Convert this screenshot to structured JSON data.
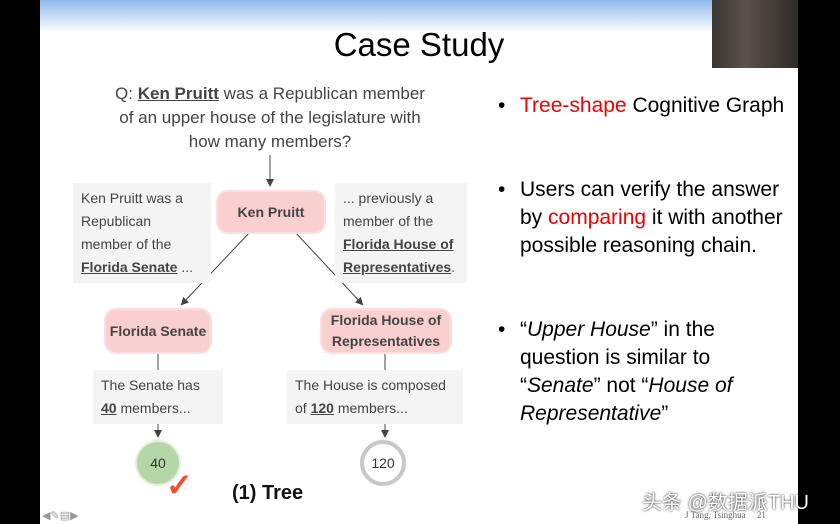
{
  "title": "Case Study",
  "question": {
    "prefix": "Q: ",
    "entity": "Ken Pruitt",
    "rest1": " was a Republican member",
    "line2": "of an upper house of the legislature with",
    "line3": "how many members?"
  },
  "boxes": {
    "left": {
      "text": "Ken Pruitt was a Republican member of the ",
      "link": "Florida Senate",
      "suffix": " ..."
    },
    "right": {
      "text": "... previously a member of the ",
      "link": "Florida House of Representatives",
      "suffix": "."
    },
    "senate": {
      "text": "The Senate has ",
      "num": "40",
      "suffix": " members..."
    },
    "house": {
      "text": "The House is composed of ",
      "num": "120",
      "suffix": " members..."
    }
  },
  "nodes": {
    "root": "Ken Pruitt",
    "senate": "Florida Senate",
    "house": "Florida House of Representatives"
  },
  "answers": {
    "correct": "40",
    "wrong": "120",
    "correct_color": "#b5d6a7",
    "wrong_color": "#c8c8c8"
  },
  "caption": "(1) Tree",
  "bullets": [
    {
      "red": "Tree-shape",
      "text": " Cognitive Graph"
    },
    {
      "text1": "Users can verify the answer by ",
      "red": "comparing",
      "text2": " it with another possible reasoning chain."
    },
    {
      "q1": "“",
      "i1": "Upper House",
      "t1": "” in the question is similar to “",
      "i2": "Senate",
      "t2": "” not “",
      "i3": "House of Representative",
      "t3": "”"
    }
  ],
  "footer": "J Tang, Tsinghua",
  "page": "21",
  "watermark": "头条 @数据派THU",
  "accent": "#e00000"
}
